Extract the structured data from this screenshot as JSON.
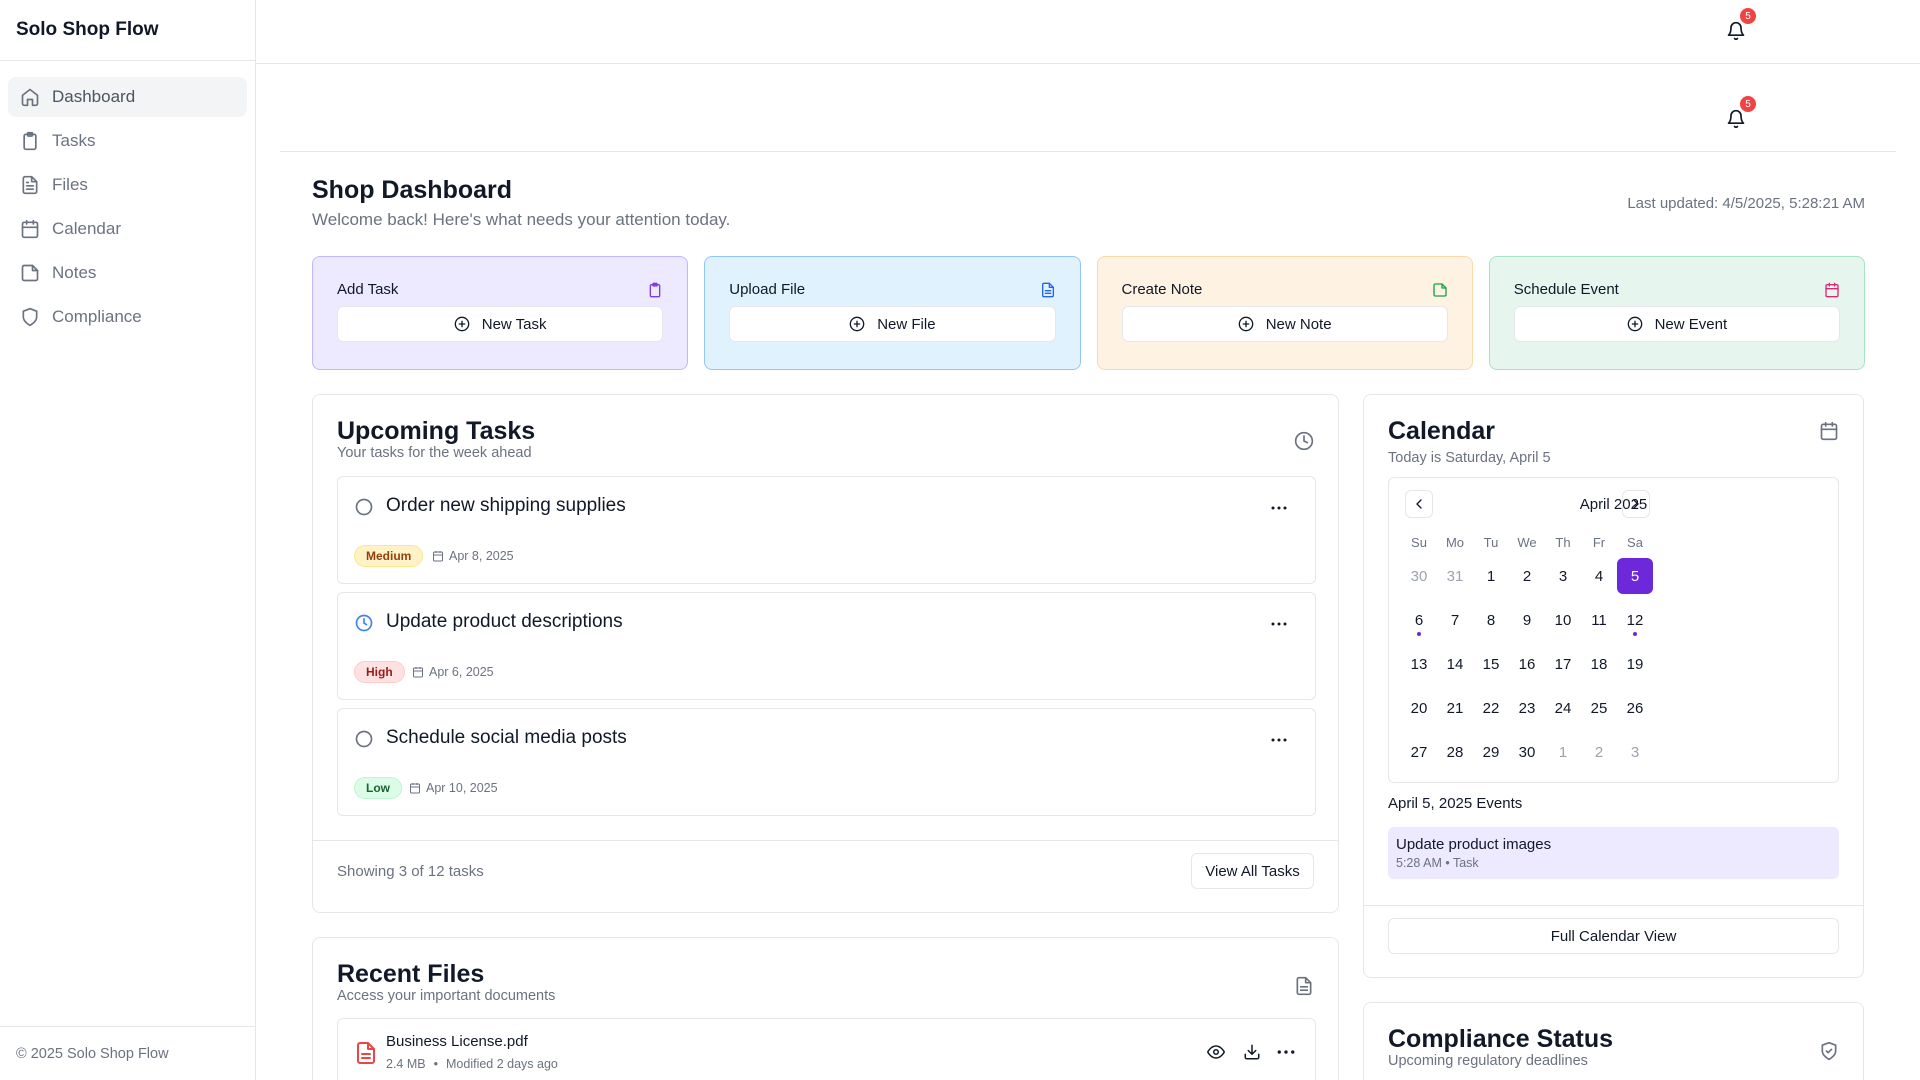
{
  "app": {
    "name": "Solo Shop Flow",
    "footer": "© 2025 Solo Shop Flow"
  },
  "sidebar": {
    "items": [
      {
        "label": "Dashboard",
        "icon": "home-icon",
        "active": true
      },
      {
        "label": "Tasks",
        "icon": "clipboard-icon"
      },
      {
        "label": "Files",
        "icon": "file-icon"
      },
      {
        "label": "Calendar",
        "icon": "calendar-icon"
      },
      {
        "label": "Notes",
        "icon": "note-icon"
      },
      {
        "label": "Compliance",
        "icon": "shield-icon"
      }
    ]
  },
  "header": {
    "notifications": "5"
  },
  "page": {
    "title": "Shop Dashboard",
    "subtitle": "Welcome back! Here's what needs your attention today.",
    "last_updated": "Last updated: 4/5/2025, 5:28:21 AM"
  },
  "quick_actions": [
    {
      "title": "Add Task",
      "button": "New Task",
      "bg": "#ede9fe",
      "border": "#c4b5fd",
      "icon_color": "#7c3aed"
    },
    {
      "title": "Upload File",
      "button": "New File",
      "bg": "#e0f2fe",
      "border": "#93c5fd",
      "icon_color": "#2563eb"
    },
    {
      "title": "Create Note",
      "button": "New Note",
      "bg": "#fef3e2",
      "border": "#fcd9a8",
      "icon_color": "#16a34a"
    },
    {
      "title": "Schedule Event",
      "button": "New Event",
      "bg": "#e6f6ef",
      "border": "#a7e3c6",
      "icon_color": "#db2777"
    }
  ],
  "tasks": {
    "title": "Upcoming Tasks",
    "subtitle": "Your tasks for the week ahead",
    "items": [
      {
        "title": "Order new shipping supplies",
        "priority": "Medium",
        "date": "Apr 8, 2025",
        "status": "open"
      },
      {
        "title": "Update product descriptions",
        "priority": "High",
        "date": "Apr 6, 2025",
        "status": "in-progress"
      },
      {
        "title": "Schedule social media posts",
        "priority": "Low",
        "date": "Apr 10, 2025",
        "status": "open"
      }
    ],
    "showing": "Showing 3 of 12 tasks",
    "view_all": "View All Tasks"
  },
  "calendar": {
    "title": "Calendar",
    "subtitle": "Today is Saturday, April 5",
    "month": "April 2025",
    "dow": [
      "Su",
      "Mo",
      "Tu",
      "We",
      "Th",
      "Fr",
      "Sa"
    ],
    "weeks": [
      [
        "30",
        "31",
        "1",
        "2",
        "3",
        "4",
        "5"
      ],
      [
        "6",
        "7",
        "8",
        "9",
        "10",
        "11",
        "12"
      ],
      [
        "13",
        "14",
        "15",
        "16",
        "17",
        "18",
        "19"
      ],
      [
        "20",
        "21",
        "22",
        "23",
        "24",
        "25",
        "26"
      ],
      [
        "27",
        "28",
        "29",
        "30",
        "1",
        "2",
        "3"
      ]
    ],
    "events_title": "April 5, 2025 Events",
    "event": {
      "title": "Update product images",
      "meta": "5:28 AM • Task"
    },
    "full_view": "Full Calendar View"
  },
  "files": {
    "title": "Recent Files",
    "subtitle": "Access your important documents",
    "items": [
      {
        "name": "Business License.pdf",
        "size": "2.4 MB",
        "modified": "Modified 2 days ago"
      }
    ]
  },
  "compliance": {
    "title": "Compliance Status",
    "subtitle": "Upcoming regulatory deadlines"
  }
}
